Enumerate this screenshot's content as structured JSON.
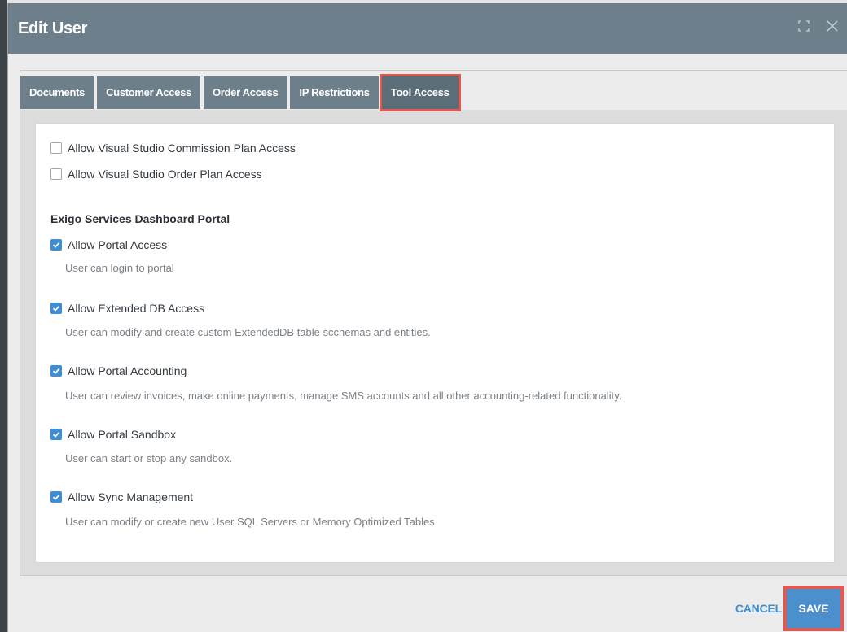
{
  "dialog": {
    "title": "Edit User"
  },
  "tabs": [
    {
      "label": "Documents",
      "active": false
    },
    {
      "label": "Customer Access",
      "active": false
    },
    {
      "label": "Order Access",
      "active": false
    },
    {
      "label": "IP Restrictions",
      "active": false
    },
    {
      "label": "Tool Access",
      "active": true
    }
  ],
  "tool_access": {
    "visual_studio": [
      {
        "label": "Allow Visual Studio Commission Plan Access",
        "checked": false
      },
      {
        "label": "Allow Visual Studio Order Plan Access",
        "checked": false
      }
    ],
    "portal_section_title": "Exigo Services Dashboard Portal",
    "portal_options": [
      {
        "label": "Allow Portal Access",
        "description": "User can login to portal",
        "checked": true
      },
      {
        "label": "Allow Extended DB Access",
        "description": "User can modify and create custom ExtendedDB table scchemas and entities.",
        "checked": true
      },
      {
        "label": "Allow Portal Accounting",
        "description": "User can review invoices, make online payments, manage SMS accounts and all other accounting-related functionality.",
        "checked": true
      },
      {
        "label": "Allow Portal Sandbox",
        "description": "User can start or stop any sandbox.",
        "checked": true
      },
      {
        "label": "Allow Sync Management",
        "description": "User can modify or create new User SQL Servers or Memory Optimized Tables",
        "checked": true
      }
    ]
  },
  "footer": {
    "cancel_label": "CANCEL",
    "save_label": "SAVE"
  },
  "colors": {
    "header": "#6d7f8b",
    "accent": "#3e8ed6",
    "highlight": "#e05a54"
  }
}
